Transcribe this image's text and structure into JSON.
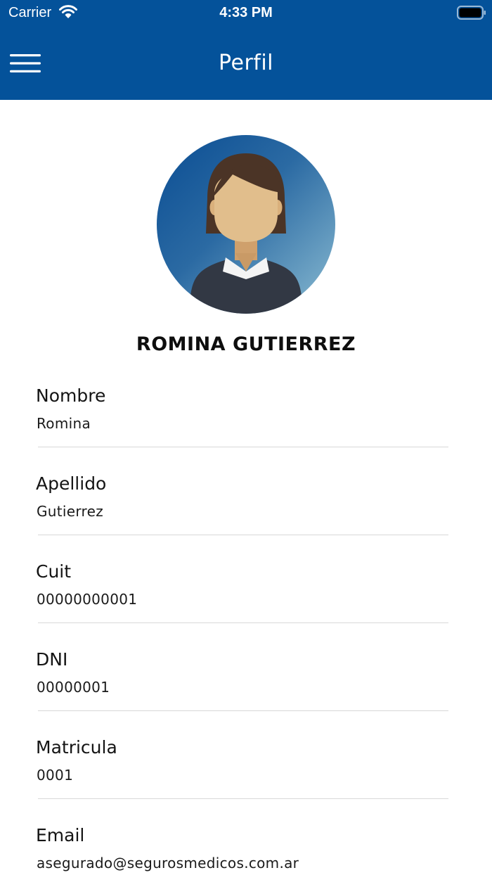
{
  "status_bar": {
    "carrier": "Carrier",
    "time": "4:33 PM"
  },
  "header": {
    "title": "Perfil",
    "background_color": "#04529a",
    "menu_icon": "hamburger-menu-icon"
  },
  "profile": {
    "full_name": "ROMINA GUTIERREZ",
    "avatar_icon": "woman-avatar-icon"
  },
  "fields": [
    {
      "label": "Nombre",
      "value": "Romina"
    },
    {
      "label": "Apellido",
      "value": "Gutierrez"
    },
    {
      "label": "Cuit",
      "value": "00000000001"
    },
    {
      "label": "DNI",
      "value": "00000001"
    },
    {
      "label": "Matricula",
      "value": "0001"
    },
    {
      "label": "Email",
      "value": "asegurado@segurosmedicos.com.ar"
    }
  ]
}
